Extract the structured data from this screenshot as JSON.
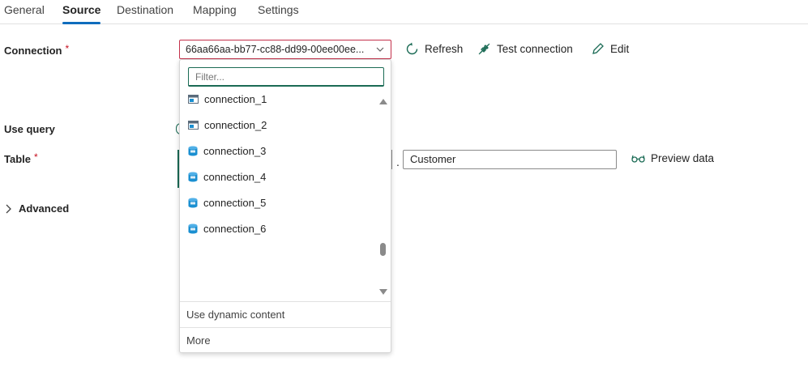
{
  "tabs": [
    {
      "label": "General"
    },
    {
      "label": "Source"
    },
    {
      "label": "Destination"
    },
    {
      "label": "Mapping"
    },
    {
      "label": "Settings"
    }
  ],
  "active_tab": "Source",
  "form": {
    "connection_label": "Connection",
    "required_mark": "*",
    "connection_value": "66aa66aa-bb77-cc88-dd99-00ee00ee...",
    "use_query_label": "Use query",
    "table_label": "Table",
    "table_separator": ".",
    "table_value": "Customer",
    "advanced_label": "Advanced"
  },
  "actions": {
    "refresh": "Refresh",
    "test_connection": "Test connection",
    "edit": "Edit",
    "preview_data": "Preview data"
  },
  "dropdown": {
    "filter_placeholder": "Filter...",
    "items": [
      {
        "label": "connection_1",
        "icon": "server-icon"
      },
      {
        "label": "connection_2",
        "icon": "server-icon"
      },
      {
        "label": "connection_3",
        "icon": "sql-database-icon"
      },
      {
        "label": "connection_4",
        "icon": "sql-database-icon"
      },
      {
        "label": "connection_5",
        "icon": "sql-database-icon"
      },
      {
        "label": "connection_6",
        "icon": "sql-database-icon"
      }
    ],
    "dynamic_content": "Use dynamic content",
    "more": "More"
  },
  "colors": {
    "accent": "#0f6cbd",
    "focus": "#1b6b55",
    "error": "#c4314b",
    "db_icon": "#1a8fd1"
  }
}
